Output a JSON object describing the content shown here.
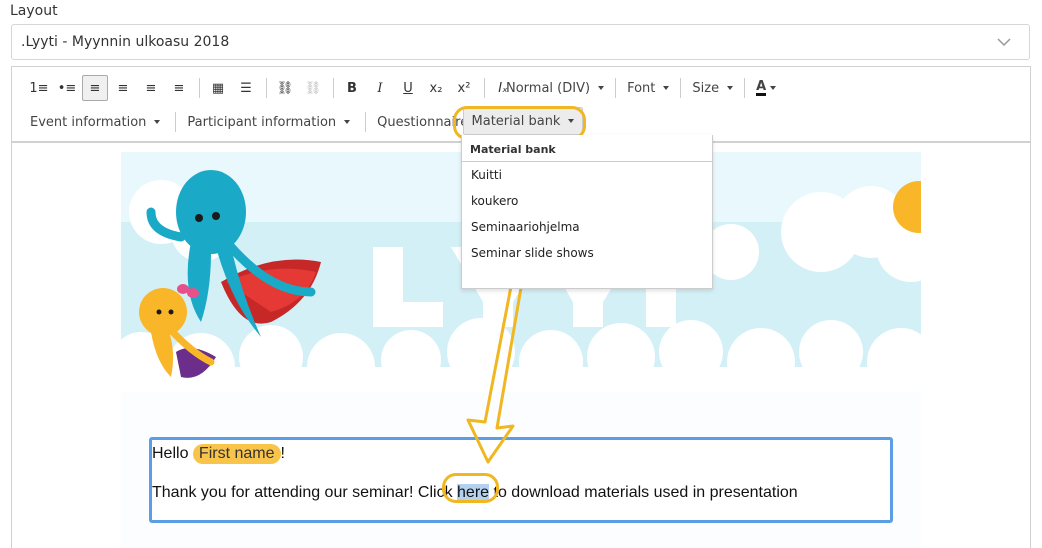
{
  "layout": {
    "label": "Layout",
    "selected": ".Lyyti - Myynnin ulkoasu 2018"
  },
  "toolbar": {
    "row1": [
      {
        "name": "numbered-list-icon",
        "glyph": "1≡"
      },
      {
        "name": "bullet-list-icon",
        "glyph": "•≡"
      },
      {
        "name": "align-left-icon",
        "glyph": "≡",
        "active": true
      },
      {
        "name": "align-center-icon",
        "glyph": "≡"
      },
      {
        "name": "align-right-icon",
        "glyph": "≡"
      },
      {
        "name": "justify-icon",
        "glyph": "≡"
      },
      {
        "sep": true
      },
      {
        "name": "table-icon",
        "glyph": "▦"
      },
      {
        "name": "horizontal-rule-icon",
        "glyph": "☰"
      },
      {
        "sep": true
      },
      {
        "name": "link-icon",
        "glyph": "⛓"
      },
      {
        "name": "unlink-icon",
        "glyph": "⛓",
        "disabled": true
      },
      {
        "sep": true
      },
      {
        "name": "bold-icon",
        "glyph": "B",
        "style": "font-weight:bold"
      },
      {
        "name": "italic-icon",
        "glyph": "I",
        "style": "font-style:italic;font-family:'DejaVu Serif',serif"
      },
      {
        "name": "underline-icon",
        "glyph": "U",
        "style": "text-decoration:underline"
      },
      {
        "name": "subscript-icon",
        "glyph": "x₂"
      },
      {
        "name": "superscript-icon",
        "glyph": "x²"
      },
      {
        "sep": true
      },
      {
        "name": "clear-format-icon",
        "glyph": "Iₓ",
        "style": "font-style:italic"
      }
    ],
    "format_label": "Normal (DIV)",
    "font_label": "Font",
    "size_label": "Size",
    "color_label": "A",
    "row2": [
      "Event information",
      "Participant information",
      "Questionnaires"
    ],
    "material_bank_label": "Material bank"
  },
  "dropdown": {
    "header": "Material bank",
    "items": [
      "Kuitti",
      "koukero",
      "Seminaariohjelma",
      "Seminar slide shows"
    ]
  },
  "email": {
    "greeting": "Hello",
    "first_name_tag": "First name",
    "exclaim": "!",
    "body_before": "Thank you for attending our seminar! Click ",
    "link_text": "here",
    "body_after": " to download materials used in presentation"
  },
  "colors": {
    "highlight": "#f1b722",
    "selection_border": "#5b9ee5",
    "tag_bg": "#f8c54a"
  }
}
